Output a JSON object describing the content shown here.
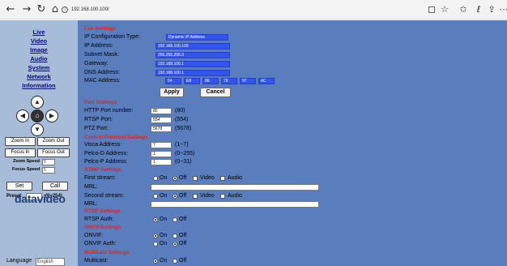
{
  "browser": {
    "url": "192.168.100.100/",
    "back_glyph": "←",
    "forward_glyph": "→",
    "refresh_glyph": "↻",
    "home_glyph": "⌂",
    "star_glyph": "☆",
    "favorites_glyph": "✩",
    "reading_glyph": "ℓ",
    "share_glyph": "⇪",
    "more_glyph": "⋯"
  },
  "sidebar": {
    "links": [
      "Live",
      "Video",
      "Image",
      "Audio",
      "System",
      "Network",
      "Information"
    ],
    "ptz": {
      "up": "▲",
      "left": "◀",
      "home": "⌂",
      "right": "▶",
      "down": "▼"
    },
    "zoom_in": "Zoom In",
    "zoom_out": "Zoom Out",
    "focus_in": "Focus In",
    "focus_out": "Focus Out",
    "zoom_speed_label": "Zoom Speed",
    "zoom_speed_value": "5",
    "focus_speed_label": "Focus Speed",
    "focus_speed_value": "5",
    "set": "Set",
    "call": "Call",
    "preset_label": "Preset",
    "preset_range": "(0~254)",
    "logo": "datavideo",
    "language_label": "Language",
    "language_value": "English"
  },
  "lan": {
    "title": "Lan Settings",
    "ip_config_label": "IP Configuration Type:",
    "ip_config_value": "Dynamic IP Address",
    "ip_label": "IP Address:",
    "ip_value": "192.168.100.100",
    "subnet_label": "Subnet Mask:",
    "subnet_value": "255.255.255.0",
    "gateway_label": "Gateway:",
    "gateway_value": "192.168.100.1",
    "dns_label": "DNS Address:",
    "dns_value": "192.168.100.1",
    "mac_label": "MAC Address:",
    "mac": [
      "04",
      "E8",
      "8E",
      "78",
      "97",
      "4C"
    ],
    "apply": "Apply",
    "cancel": "Cancel"
  },
  "ports": {
    "title": "Port Settings",
    "http_label": "HTTP Port number:",
    "http_value": "80",
    "http_hint": "(80)",
    "rtsp_label": "RTSP Port:",
    "rtsp_value": "554",
    "rtsp_hint": "(554)",
    "ptz_label": "PTZ Port:",
    "ptz_value": "5678",
    "ptz_hint": "(5678)"
  },
  "control": {
    "title": "Control Protocol Settings",
    "visca_label": "Visca Address:",
    "visca_value": "7",
    "visca_hint": "(1~7)",
    "pelcod_label": "Pelco-D Address:",
    "pelcod_value": "1",
    "pelcod_hint": "(0~255)",
    "pelcop_label": "Pelco-P Address:",
    "pelcop_value": "1",
    "pelcop_hint": "(0~31)"
  },
  "rtmp": {
    "title": "RTMP Settings",
    "first_label": "First stream:",
    "mrl_label": "MRL:",
    "second_label": "Second stream:",
    "on": "On",
    "off": "Off",
    "video": "Video",
    "audio": "Audio"
  },
  "rtsp": {
    "title": "RTSP Settings",
    "auth_label": "RTSP Auth:",
    "on": "On",
    "off": "Off"
  },
  "onvif": {
    "title": "ONVIFSettings",
    "onvif_label": "ONVIF:",
    "auth_label": "ONVIF Auth:",
    "on": "On",
    "off": "Off"
  },
  "multicast": {
    "title": "Multicast Settings",
    "label": "Multicast:",
    "on": "On",
    "off": "Off"
  }
}
